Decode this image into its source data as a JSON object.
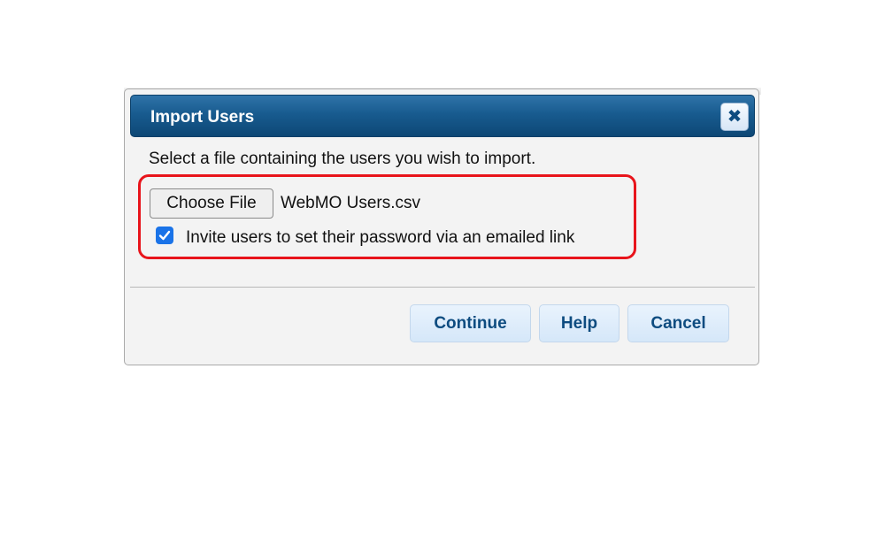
{
  "dialog": {
    "title": "Import Users",
    "close_icon": "close-icon",
    "prompt": "Select a file containing the users you wish to import.",
    "file_picker": {
      "button_label": "Choose File",
      "selected_file": "WebMO Users.csv"
    },
    "invite_option": {
      "checked": true,
      "label": "Invite users to set their password via an emailed link"
    },
    "buttons": {
      "continue": "Continue",
      "help": "Help",
      "cancel": "Cancel"
    }
  },
  "colors": {
    "titlebar": "#185b8f",
    "button_text": "#0e4c80",
    "highlight": "#e8141b",
    "checkbox": "#1a73e8"
  }
}
